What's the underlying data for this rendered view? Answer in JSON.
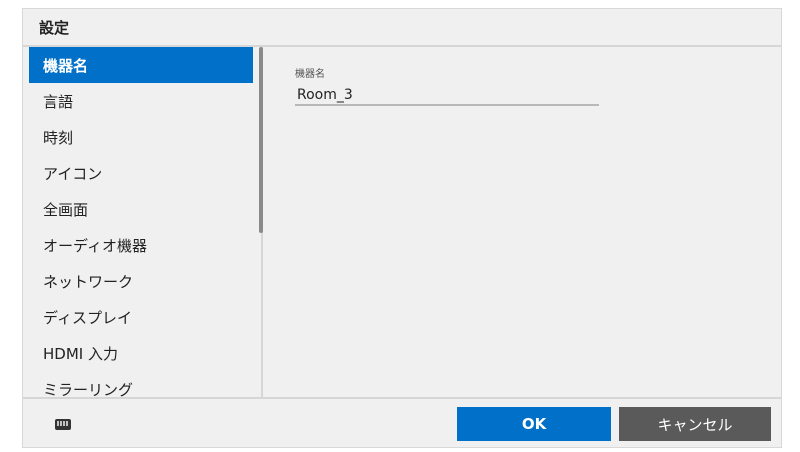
{
  "window": {
    "title": "設定"
  },
  "sidebar": {
    "items": [
      {
        "label": "機器名",
        "selected": true
      },
      {
        "label": "言語",
        "selected": false
      },
      {
        "label": "時刻",
        "selected": false
      },
      {
        "label": "アイコン",
        "selected": false
      },
      {
        "label": "全画面",
        "selected": false
      },
      {
        "label": "オーディオ機器",
        "selected": false
      },
      {
        "label": "ネットワーク",
        "selected": false
      },
      {
        "label": "ディスプレイ",
        "selected": false
      },
      {
        "label": "HDMI 入力",
        "selected": false
      },
      {
        "label": "ミラーリング",
        "selected": false
      }
    ]
  },
  "main": {
    "device_name_label": "機器名",
    "device_name_value": "Room_3"
  },
  "footer": {
    "keyboard_icon": "keyboard-icon",
    "ok_label": "OK",
    "cancel_label": "キャンセル"
  },
  "colors": {
    "accent": "#0070c8",
    "cancel": "#5a5a5a",
    "panel": "#f0f0f0"
  }
}
